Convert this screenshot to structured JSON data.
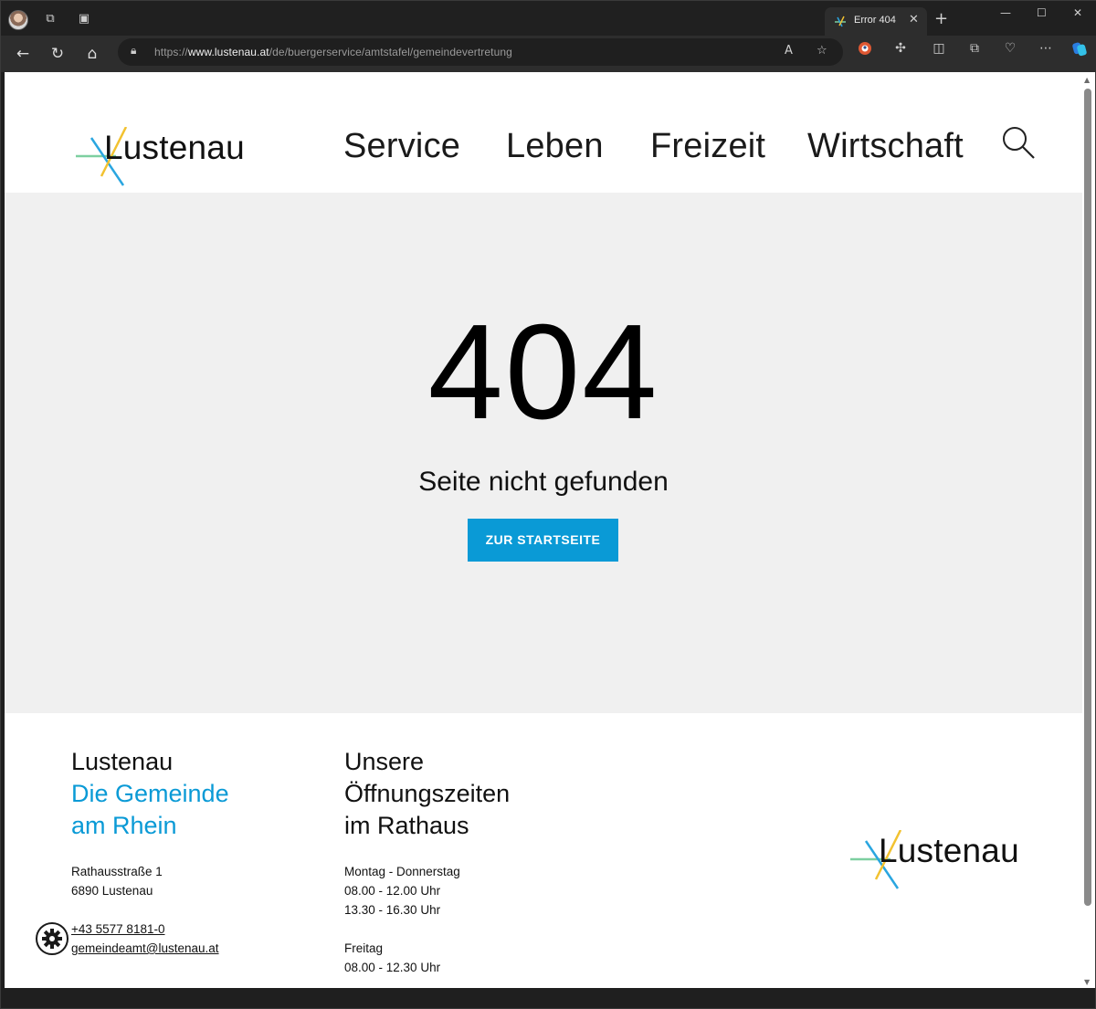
{
  "browser": {
    "tab_title": "Error 404",
    "tab_close": "✕",
    "new_tab": "+",
    "url_prefix": "https://",
    "url_domain": "www.lustenau.at",
    "url_path": "/de/buergerservice/amtstafel/gemeindevertretung"
  },
  "site": {
    "logo_text": "Lustenau",
    "nav": [
      "Service",
      "Leben",
      "Freizeit",
      "Wirtschaft"
    ]
  },
  "error": {
    "code": "404",
    "message": "Seite nicht gefunden",
    "button_label": "ZUR STARTSEITE"
  },
  "footer": {
    "col1": {
      "title": "Lustenau",
      "subtitle_line1": "Die Gemeinde",
      "subtitle_line2": "am Rhein",
      "address_line1": "Rathausstraße 1",
      "address_line2": "6890 Lustenau",
      "phone": "+43 5577 8181-0",
      "email": "gemeindeamt@lustenau.at"
    },
    "col2": {
      "title_line1": "Unsere",
      "title_line2": "Öffnungszeiten",
      "title_line3": "im Rathaus",
      "days1": "Montag - Donnerstag",
      "hours1a": "08.00 - 12.00 Uhr",
      "hours1b": "13.30 - 16.30 Uhr",
      "days2": "Freitag",
      "hours2": "08.00 - 12.30 Uhr"
    },
    "logo_text": "Lustenau"
  },
  "colors": {
    "accent_blue": "#0a9ad6",
    "logo_yellow": "#f2c230",
    "logo_green": "#7dcfa0",
    "logo_blue": "#2aa6e0"
  }
}
